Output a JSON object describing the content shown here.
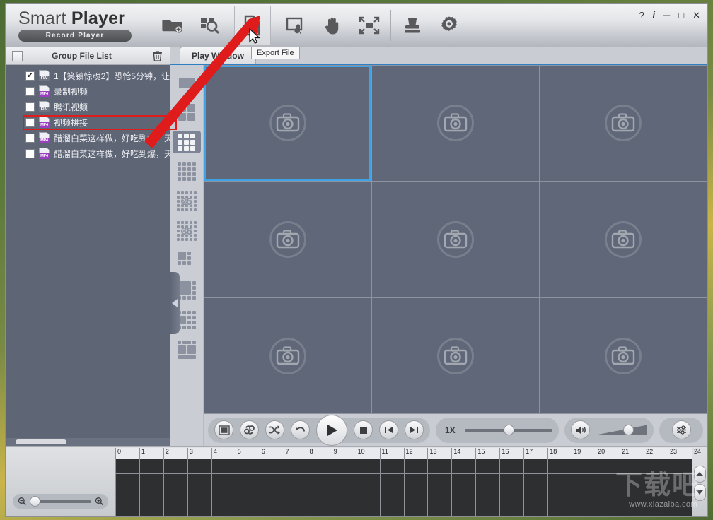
{
  "app": {
    "brand_name_light": "Smart ",
    "brand_name_bold": "Player",
    "brand_subtitle": "Record Player"
  },
  "toolbar": {
    "buttons": [
      {
        "name": "add-folder-button",
        "icon": "folder-add-icon",
        "label": "Add Folder"
      },
      {
        "name": "search-button",
        "icon": "search-icon",
        "label": "Search"
      },
      {
        "name": "export-file-button",
        "icon": "export-file-icon",
        "label": "Export File"
      },
      {
        "name": "snapshot-button",
        "icon": "snapshot-icon",
        "label": "Snapshot"
      },
      {
        "name": "pan-button",
        "icon": "hand-icon",
        "label": "Pan"
      },
      {
        "name": "fullscreen-button",
        "icon": "fullscreen-icon",
        "label": "Fullscreen"
      },
      {
        "name": "watermark-button",
        "icon": "stamp-icon",
        "label": "Watermark"
      },
      {
        "name": "settings-button",
        "icon": "gear-icon",
        "label": "Settings"
      }
    ],
    "tooltip": "Export File"
  },
  "window_controls": {
    "help": "?",
    "info": "i",
    "minimize": "─",
    "maximize": "□",
    "close": "✕"
  },
  "file_panel": {
    "title": "Group File List",
    "delete_icon": "trash-icon",
    "select_all_checked": false,
    "files": [
      {
        "checked": true,
        "type": "FLV",
        "name": "1【笑镇惊魂2】恐怆5分钟，让"
      },
      {
        "checked": false,
        "type": "MP4",
        "name": "录制视频"
      },
      {
        "checked": false,
        "type": "FLV",
        "name": "腾讯视频"
      },
      {
        "checked": false,
        "type": "MP4",
        "name": "视频拼接"
      },
      {
        "checked": false,
        "type": "MP4",
        "name": "醋溜白菜这样做，好吃到爆，天"
      },
      {
        "checked": false,
        "type": "MP4",
        "name": "醋溜白菜这样做，好吃到爆，天"
      }
    ]
  },
  "tabs": [
    {
      "name": "tab-play-window",
      "label": "Play Window",
      "active": true
    }
  ],
  "layout_bar": {
    "selected_index": 2,
    "options": [
      {
        "name": "layout-1",
        "label": "1",
        "cols": 1,
        "rows": 1
      },
      {
        "name": "layout-4",
        "label": "4",
        "cols": 2,
        "rows": 2
      },
      {
        "name": "layout-9",
        "label": "9",
        "cols": 3,
        "rows": 3
      },
      {
        "name": "layout-16",
        "label": "16",
        "cols": 4,
        "rows": 4
      },
      {
        "name": "layout-25",
        "label": "25",
        "cols": 0,
        "rows": 0
      },
      {
        "name": "layout-36",
        "label": "36",
        "cols": 0,
        "rows": 0
      },
      {
        "name": "layout-custom-6",
        "label": "6",
        "cols": 0,
        "rows": 0
      },
      {
        "name": "layout-custom-8",
        "label": "8",
        "cols": 0,
        "rows": 0
      },
      {
        "name": "layout-custom-13",
        "label": "13",
        "cols": 0,
        "rows": 0
      },
      {
        "name": "layout-custom-free",
        "label": "free",
        "cols": 0,
        "rows": 0
      }
    ]
  },
  "video_grid": {
    "columns": 3,
    "rows": 3,
    "selected_cell": 0,
    "placeholder_icon": "camera-disabled-icon",
    "cells": [
      {
        "index": 0
      },
      {
        "index": 1
      },
      {
        "index": 2
      },
      {
        "index": 3
      },
      {
        "index": 4
      },
      {
        "index": 5
      },
      {
        "index": 6
      },
      {
        "index": 7
      },
      {
        "index": 8
      }
    ]
  },
  "transport": {
    "buttons": [
      {
        "name": "stop-frame-button",
        "icon": "square-frame-icon"
      },
      {
        "name": "repeat-button",
        "icon": "repeat-icon"
      },
      {
        "name": "shuffle-button",
        "icon": "shuffle-icon"
      },
      {
        "name": "undo-button",
        "icon": "undo-arrow-icon"
      },
      {
        "name": "play-button",
        "icon": "play-icon"
      },
      {
        "name": "stop-button",
        "icon": "stop-icon"
      },
      {
        "name": "prev-frame-button",
        "icon": "step-back-icon"
      },
      {
        "name": "next-frame-button",
        "icon": "step-forward-icon"
      }
    ],
    "speed_label": "1X",
    "speed_value": 50,
    "volume_value": 62,
    "mute_icon": "speaker-icon",
    "equalizer_icon": "sliders-icon"
  },
  "timeline": {
    "zoom_value": 8,
    "zoom_out_icon": "magnifier-minus-icon",
    "zoom_in_icon": "magnifier-plus-icon",
    "scroll_up_icon": "triangle-up-icon",
    "scroll_down_icon": "triangle-down-icon",
    "track_count": 4,
    "hour_ticks": [
      "0",
      "1",
      "2",
      "3",
      "4",
      "5",
      "6",
      "7",
      "8",
      "9",
      "10",
      "11",
      "12",
      "13",
      "14",
      "15",
      "16",
      "17",
      "18",
      "19",
      "20",
      "21",
      "22",
      "23",
      "24"
    ]
  },
  "collapse_handle": {
    "name": "collapse-left-panel-handle",
    "icon": "chevron-left-icon"
  },
  "watermark": {
    "text": "www.xiazaiba.com",
    "logo": "下载吧"
  }
}
